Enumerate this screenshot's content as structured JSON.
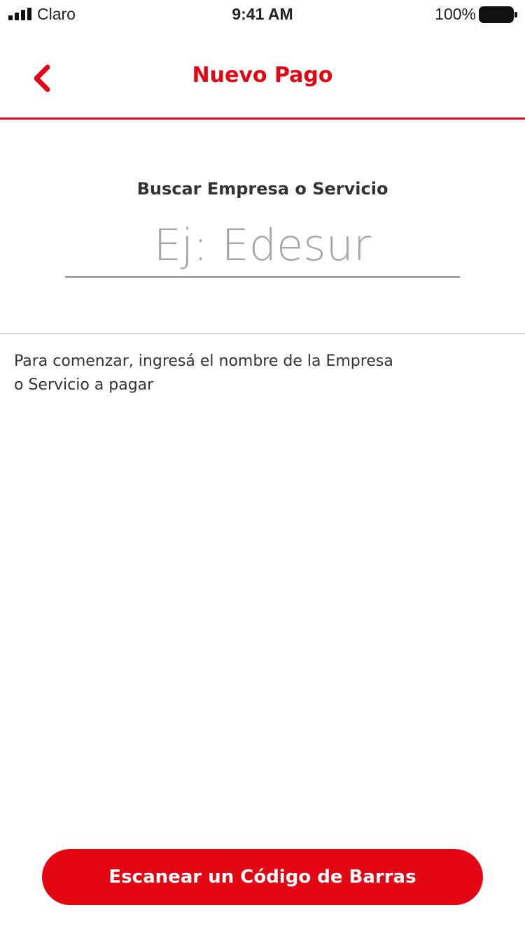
{
  "status_bar": {
    "carrier": "Claro",
    "time": "9:41 AM",
    "battery_percent": "100%",
    "signal_icon": "signal-bars-icon",
    "battery_icon": "battery-icon"
  },
  "nav": {
    "title": "Nuevo Pago",
    "back_icon": "chevron-left-icon"
  },
  "search": {
    "label": "Buscar Empresa o Servicio",
    "placeholder": "Ej: Edesur",
    "value": ""
  },
  "instructions": {
    "line1": "Para comenzar, ingresá el nombre de la Empresa",
    "line2": "o Servicio a pagar"
  },
  "actions": {
    "scan_button_label": "Escanear un Código de Barras"
  },
  "colors": {
    "accent": "#e30613",
    "text": "#333333",
    "placeholder": "#a6a6a6",
    "divider": "#d9d9d9"
  }
}
